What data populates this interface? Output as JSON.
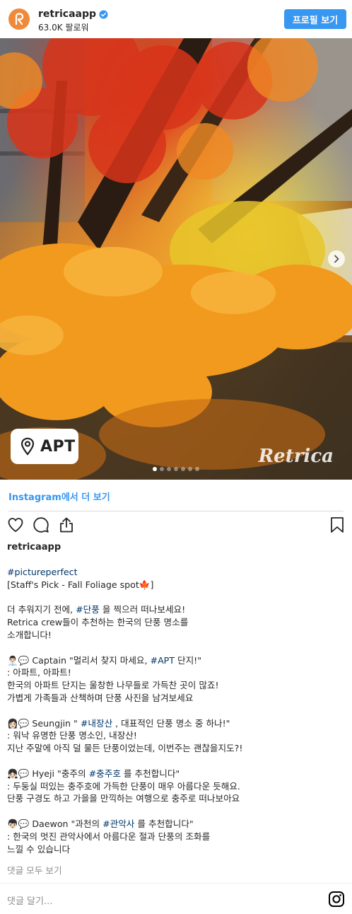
{
  "header": {
    "username": "retricaapp",
    "followers": "63.0K 팔로워",
    "profile_button": "프로필 보기"
  },
  "photo": {
    "location_label": "APT",
    "watermark": "Retrica",
    "carousel_count": 7,
    "carousel_active": 1
  },
  "more_link": "Instagram에서 더 보기",
  "caption": {
    "username": "retricaapp",
    "paragraphs": [
      {
        "lines": [
          [
            {
              "t": "#pictureperfect",
              "h": true
            }
          ],
          [
            {
              "t": "[Staff's Pick - Fall Foliage spot🍁]",
              "h": false
            }
          ]
        ]
      },
      {
        "lines": [
          [
            {
              "t": "더 추워지기 전에, ",
              "h": false
            },
            {
              "t": "#단풍",
              "h": true
            },
            {
              "t": " 을 찍으러 떠나보세요!",
              "h": false
            }
          ],
          [
            {
              "t": "Retrica crew들이 추천하는 한국의 단풍 명소를",
              "h": false
            }
          ],
          [
            {
              "t": "소개합니다!",
              "h": false
            }
          ]
        ]
      },
      {
        "lines": [
          [
            {
              "t": "👨🏻‍💼💬 Captain \"멀리서 찾지 마세요, ",
              "h": false
            },
            {
              "t": "#APT",
              "h": true
            },
            {
              "t": " 단지!\"",
              "h": false
            }
          ],
          [
            {
              "t": ": 아파트, 아파트!",
              "h": false
            }
          ],
          [
            {
              "t": "한국의 아파트 단지는 울창한 나무들로 가득찬 곳이 많죠!",
              "h": false
            }
          ],
          [
            {
              "t": "가볍게 가족들과 산책하며 단풍 사진을 남겨보세요",
              "h": false
            }
          ]
        ]
      },
      {
        "lines": [
          [
            {
              "t": "👩🏻💬 Seungjin \" ",
              "h": false
            },
            {
              "t": "#내장산",
              "h": true
            },
            {
              "t": " , 대표적인 단풍 명소 중 하나!\"",
              "h": false
            }
          ],
          [
            {
              "t": ": 워낙 유명한 단풍 명소인, 내장산!",
              "h": false
            }
          ],
          [
            {
              "t": "지난 주말에 아직 덜 물든 단풍이었는데, 이번주는 괜찮을지도?!",
              "h": false
            }
          ]
        ]
      },
      {
        "lines": [
          [
            {
              "t": "👧🏻💬 Hyeji \"충주의 ",
              "h": false
            },
            {
              "t": "#충주호",
              "h": true
            },
            {
              "t": " 를 추천합니다\"",
              "h": false
            }
          ],
          [
            {
              "t": ": 두둥실 떠있는 충주호에 가득한 단풍이 매우 아름다운 듯해요.",
              "h": false
            }
          ],
          [
            {
              "t": "단풍 구경도 하고 가을을 만끽하는 여행으로 충주로 떠나보아요",
              "h": false
            }
          ]
        ]
      },
      {
        "lines": [
          [
            {
              "t": "👦🏻💬 Daewon \"과천의 ",
              "h": false
            },
            {
              "t": "#관악사",
              "h": true
            },
            {
              "t": " 를 추천합니다\"",
              "h": false
            }
          ],
          [
            {
              "t": ": 한국의 멋진 관악사에서 아름다운 절과 단풍의 조화를",
              "h": false
            }
          ],
          [
            {
              "t": "느낄 수 있습니다",
              "h": false
            }
          ]
        ]
      }
    ]
  },
  "view_all_comments": "댓글 모두 보기",
  "comment_placeholder": "댓글 달기...",
  "colors": {
    "accent": "#3897f0",
    "hashtag": "#003569",
    "avatar": "#f08a3a"
  }
}
